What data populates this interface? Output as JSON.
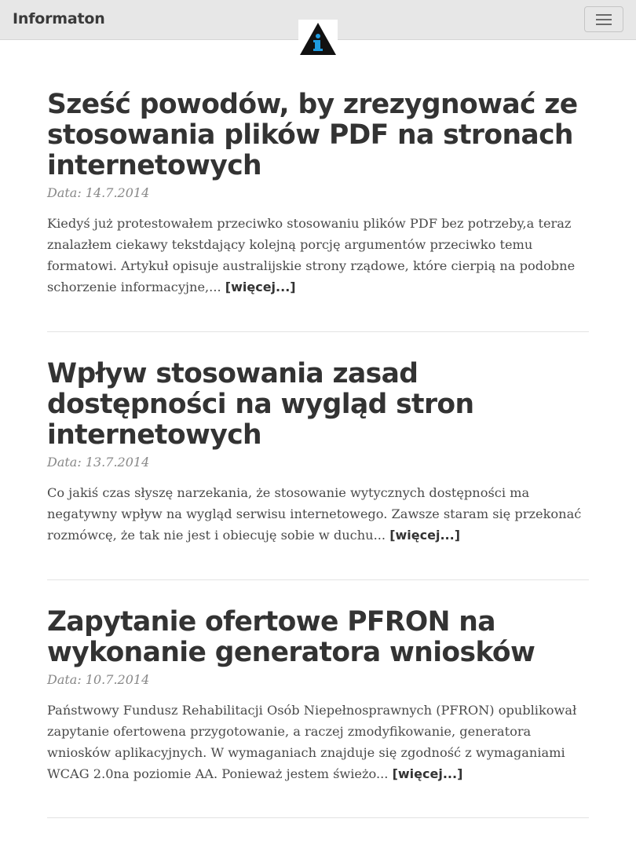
{
  "navbar": {
    "brand": "Informaton",
    "logo_icon": "info-triangle-logo",
    "menu_icon": "hamburger-menu-icon"
  },
  "articles": [
    {
      "title": "Sześć powodów, by zrezygnować ze stosowania plików PDF na stronach internetowych",
      "date": "Data: 14.7.2014",
      "excerpt": "Kiedyś już protestowałem przeciwko stosowaniu plików PDF bez potrzeby,a teraz znalazłem ciekawy tekstdający kolejną porcję argumentów przeciwko temu formatowi. Artykuł opisuje australijskie strony rządowe, które cierpią na podobne schorzenie informacyjne,...",
      "more": "[więcej...]"
    },
    {
      "title": "Wpływ stosowania zasad dostępności na wygląd stron internetowych",
      "date": "Data: 13.7.2014",
      "excerpt": "Co jakiś czas słyszę narzekania, że stosowanie wytycznych dostępności ma negatywny wpływ na wygląd serwisu internetowego. Zawsze staram się przekonać rozmówcę, że tak nie jest i obiecuję sobie w duchu...",
      "more": "[więcej...]"
    },
    {
      "title": "Zapytanie ofertowe PFRON na wykonanie generatora wniosków",
      "date": "Data: 10.7.2014",
      "excerpt": "Państwowy Fundusz Rehabilitacji Osób Niepełnosprawnych (PFRON) opublikował zapytanie ofertowena przygotowanie, a raczej zmodyfikowanie, generatora wniosków aplikacyjnych. W wymaganiach znajduje się zgodność z wymaganiami WCAG 2.0na poziomie AA. Ponieważ jestem świeżo...",
      "more": "[więcej...]"
    }
  ],
  "colors": {
    "navbar_bg": "#e7e7e7",
    "logo_triangle": "#111111",
    "logo_glyph": "#1e9be0",
    "text": "#333333",
    "date": "#888888"
  }
}
